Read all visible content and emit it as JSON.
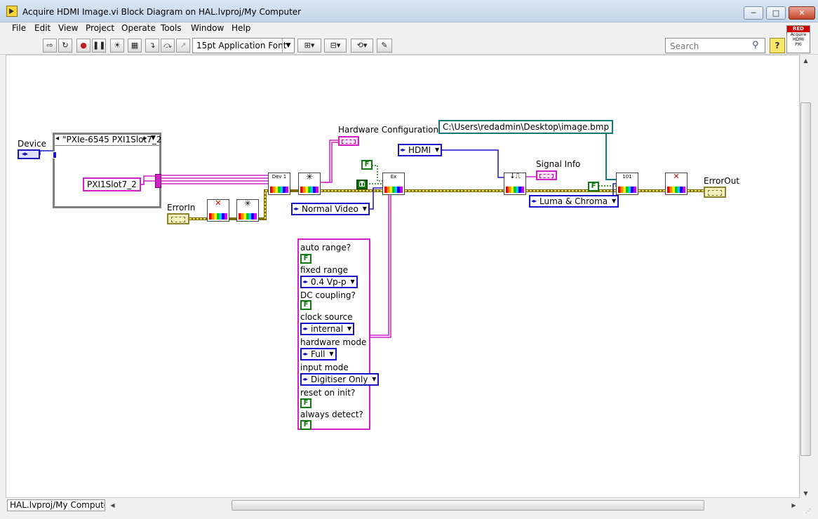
{
  "window": {
    "title": "Acquire HDMI Image.vi Block Diagram on HAL.lvproj/My Computer",
    "minimize": "─",
    "maximize": "□",
    "close": "✕"
  },
  "menu": {
    "file": "File",
    "edit": "Edit",
    "view": "View",
    "project": "Project",
    "operate": "Operate",
    "tools": "Tools",
    "window": "Window",
    "help": "Help"
  },
  "toolbar": {
    "font": "15pt Application Font",
    "search_placeholder": "Search",
    "help": "?",
    "project_icon": {
      "brand": "RED",
      "line1": "Acquire",
      "line2": "HDMI",
      "line3": "PXI"
    }
  },
  "diagram": {
    "device_label": "Device",
    "resource_header": "\"PXIe-6545 PXI1Slot7_2",
    "resource_string": "PXI1Slot7_2",
    "errorin_label": "ErrorIn",
    "hw_config_label": "Hardware Configuration",
    "signal_info_label": "Signal Info",
    "errorout_label": "ErrorOut",
    "path": "C:\\Users\\redadmin\\Desktop\\image.bmp",
    "enum_hdmi": "HDMI",
    "enum_video": "Normal Video",
    "enum_color": "Luma & Chroma",
    "bool_f": "F",
    "bool_t": "T",
    "init_label": "Dev 1",
    "config_label": "Ex",
    "acq_label": "101",
    "cluster": {
      "auto_range_label": "auto range?",
      "fixed_range_label": "fixed range",
      "fixed_range_value": "0.4 Vp-p",
      "dc_coupling_label": "DC coupling?",
      "clock_source_label": "clock source",
      "clock_source_value": "internal",
      "hardware_mode_label": "hardware mode",
      "hardware_mode_value": "Full",
      "input_mode_label": "input mode",
      "input_mode_value": "Digitiser Only",
      "reset_label": "reset on init?",
      "always_detect_label": "always detect?"
    }
  },
  "status": {
    "context": "HAL.lvproj/My Computer"
  }
}
